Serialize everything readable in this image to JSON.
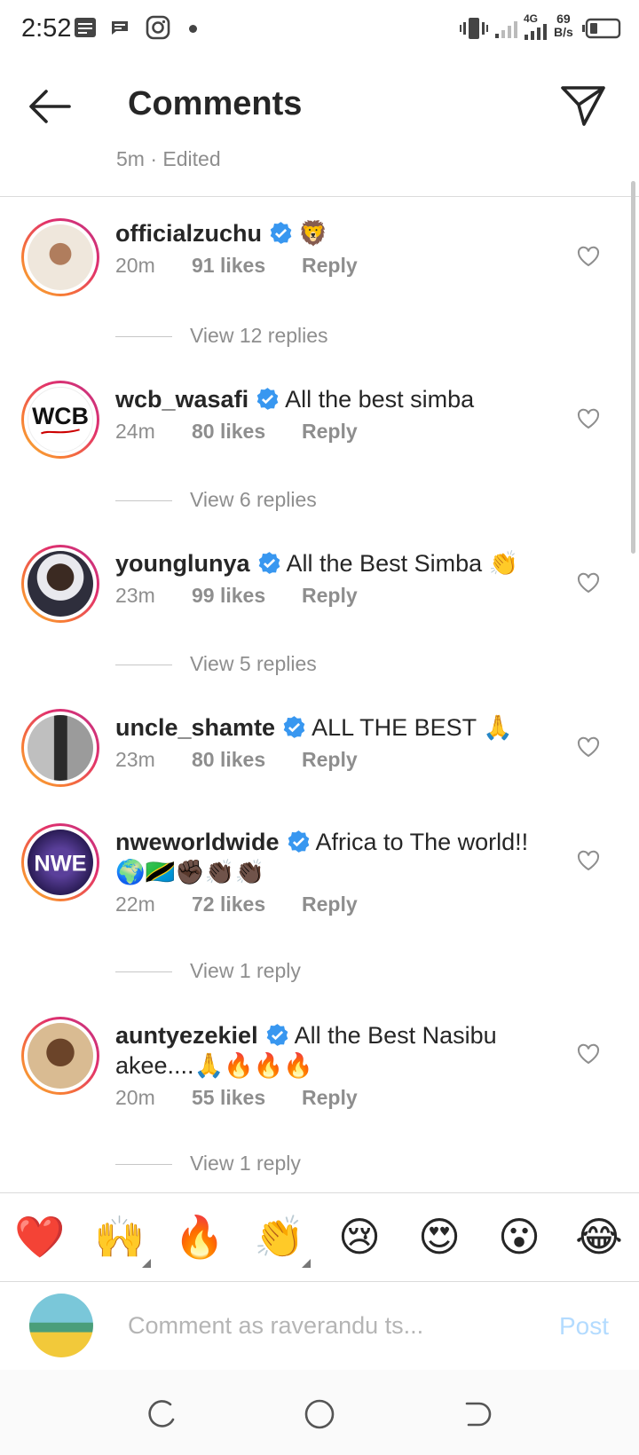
{
  "status_bar": {
    "time": "2:52",
    "network": "4G",
    "speed_value": "69",
    "speed_unit": "B/s"
  },
  "header": {
    "title": "Comments"
  },
  "partial_meta": "5m · Edited",
  "comments": [
    {
      "username": "officialzuchu",
      "text": "🦁",
      "time": "20m",
      "likes": "91 likes",
      "reply": "Reply",
      "view_replies": "View 12 replies",
      "avatar_colors": [
        "#f3efe8",
        "#8a6a50"
      ]
    },
    {
      "username": "wcb_wasafi",
      "text": "All the best simba",
      "time": "24m",
      "likes": "80 likes",
      "reply": "Reply",
      "view_replies": "View 6 replies",
      "avatar_colors": [
        "#ffffff",
        "#111111"
      ]
    },
    {
      "username": "younglunya",
      "text": "All the Best Simba 👏",
      "time": "23m",
      "likes": "99 likes",
      "reply": "Reply",
      "view_replies": "View 5 replies",
      "avatar_colors": [
        "#3a3a4a",
        "#dddddd"
      ]
    },
    {
      "username": "uncle_shamte",
      "text": "ALL THE BEST 🙏",
      "time": "23m",
      "likes": "80 likes",
      "reply": "Reply",
      "avatar_colors": [
        "#9a9a9a",
        "#2a2a2a"
      ]
    },
    {
      "username": "nweworldwide",
      "text": "Africa to The world!! 🌍🇹🇿✊🏿👏🏿👏🏿",
      "time": "22m",
      "likes": "72 likes",
      "reply": "Reply",
      "view_replies": "View 1 reply",
      "avatar_colors": [
        "#3b2a6b",
        "#ffffff"
      ]
    },
    {
      "username": "auntyezekiel",
      "text": "All the Best Nasibu akee....🙏🔥🔥🔥",
      "time": "20m",
      "likes": "55 likes",
      "reply": "Reply",
      "view_replies": "View 1 reply",
      "avatar_colors": [
        "#d7b890",
        "#5a3a22"
      ]
    }
  ],
  "emoji_bar": [
    "❤️",
    "🙌",
    "🔥",
    "👏",
    "😢",
    "😍",
    "😮",
    "😂"
  ],
  "composer": {
    "placeholder": "Comment as raverandu ts...",
    "post_label": "Post"
  },
  "colors": {
    "text": "#262626",
    "secondary": "#8e8e8e",
    "verified": "#3897f0",
    "post_disabled": "#b3dbff"
  }
}
